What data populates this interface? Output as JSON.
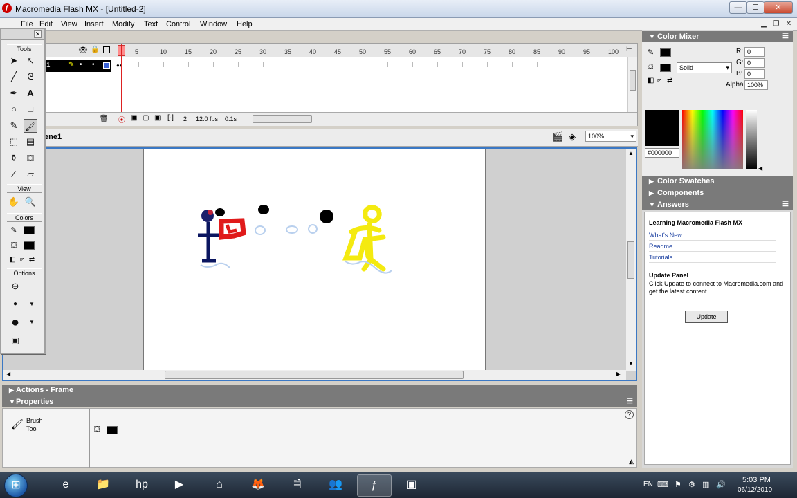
{
  "window": {
    "title": "Macromedia Flash MX - [Untitled-2]",
    "minimize_glyph": "—",
    "maximize_glyph": "☐",
    "close_glyph": "✕"
  },
  "menu": [
    "File",
    "Edit",
    "View",
    "Insert",
    "Modify",
    "Text",
    "Control",
    "Window",
    "Help"
  ],
  "tools_panel": {
    "title": "Tools",
    "view_label": "View",
    "colors_label": "Colors",
    "options_label": "Options"
  },
  "timeline": {
    "frame_numbers": [
      "5",
      "10",
      "15",
      "20",
      "25",
      "30",
      "35",
      "40",
      "45",
      "50",
      "55",
      "60",
      "65",
      "70",
      "75",
      "80",
      "85",
      "90",
      "95",
      "100"
    ],
    "layer_number": "1",
    "current_frame": "2",
    "fps": "12.0 fps",
    "elapsed": "0.1s"
  },
  "scene": {
    "label": "ene1"
  },
  "zoom": "100%",
  "panels": {
    "actions": "Actions - Frame",
    "properties": "Properties"
  },
  "properties": {
    "tool_name_line1": "Brush",
    "tool_name_line2": "Tool"
  },
  "color_mixer": {
    "title": "Color Mixer",
    "r_label": "R:",
    "r_value": "0",
    "g_label": "G:",
    "g_value": "0",
    "b_label": "B:",
    "b_value": "0",
    "alpha_label": "Alpha:",
    "alpha_value": "100%",
    "fill_style": "Solid",
    "hex": "#000000"
  },
  "color_swatches": {
    "title": "Color Swatches"
  },
  "components": {
    "title": "Components"
  },
  "answers": {
    "title": "Answers",
    "heading": "Learning Macromedia Flash MX",
    "links": [
      "What's New",
      "Readme",
      "Tutorials"
    ],
    "update_heading": "Update Panel",
    "update_text": "Click Update to connect to Macromedia.com and get the latest content.",
    "update_button": "Update"
  },
  "taskbar": {
    "language": "EN",
    "time": "5:03 PM",
    "date": "06/12/2010"
  },
  "colors": {
    "accent_blue": "#3b78c4",
    "panel_header": "#7a7a7a",
    "stroke_color": "#000000",
    "fill_color": "#000000"
  }
}
